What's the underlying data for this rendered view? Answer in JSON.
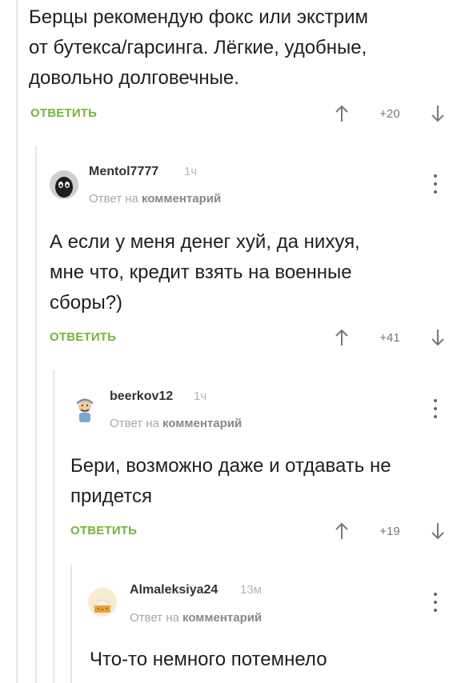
{
  "top_comment": {
    "text_lines": [
      "Берцы рекомендую фокс или экстрим",
      "от бутекса/гарсинга. Лёгкие, удобные,",
      "довольно долговечные."
    ],
    "reply_label": "ОТВЕТИТЬ",
    "rating": "+20"
  },
  "comments": [
    {
      "username": "Mentol7777",
      "time": "1ч",
      "reply_to_prefix": "Ответ на",
      "reply_to_link": "комментарий",
      "text_lines": [
        "А если у меня денег хуй, да нихуя,",
        "мне что, кредит взять на военные",
        "сборы?)"
      ],
      "reply_label": "ОТВЕТИТЬ",
      "rating": "+41"
    },
    {
      "username": "beerkov12",
      "time": "1ч",
      "reply_to_prefix": "Ответ на",
      "reply_to_link": "комментарий",
      "text_lines": [
        "Бери, возможно даже и отдавать не",
        "придется"
      ],
      "reply_label": "ОТВЕТИТЬ",
      "rating": "+19"
    },
    {
      "username": "Almaleksiya24",
      "time": "13м",
      "reply_to_prefix": "Ответ на",
      "reply_to_link": "комментарий",
      "text_lines": [
        "Что-то немного потемнело"
      ]
    }
  ],
  "colors": {
    "accent": "#74b53a",
    "muted": "#a8a8a8",
    "thread_line": "#e7e7e7"
  },
  "icons": [
    "upvote-arrow-icon",
    "downvote-arrow-icon",
    "more-vertical-icon",
    "avatar"
  ]
}
